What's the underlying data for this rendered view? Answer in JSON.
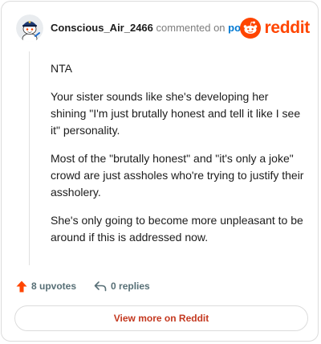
{
  "comment": {
    "author": "Conscious_Air_2466",
    "commented_on": "commented on",
    "post_link": "post",
    "paragraphs": [
      "NTA",
      "Your sister sounds like she's developing her shining \"I'm just brutally honest and tell it like I see it\" personality.",
      "Most of the \"brutally honest\" and \"it's only a joke\" crowd are just assholes who're trying to justify their assholery.",
      "She's only going to become more unpleasant to be around if this is addressed now."
    ]
  },
  "brand": {
    "wordmark": "reddit",
    "logo_icon": "reddit-snoo-icon",
    "color": "#ff4500"
  },
  "footer": {
    "upvotes_label": "8 upvotes",
    "replies_label": "0 replies",
    "upvote_icon": "upvote-arrow-icon",
    "reply_icon": "reply-arrow-icon",
    "upvote_color": "#ff4500"
  },
  "view_button": {
    "label": "View more on Reddit"
  }
}
